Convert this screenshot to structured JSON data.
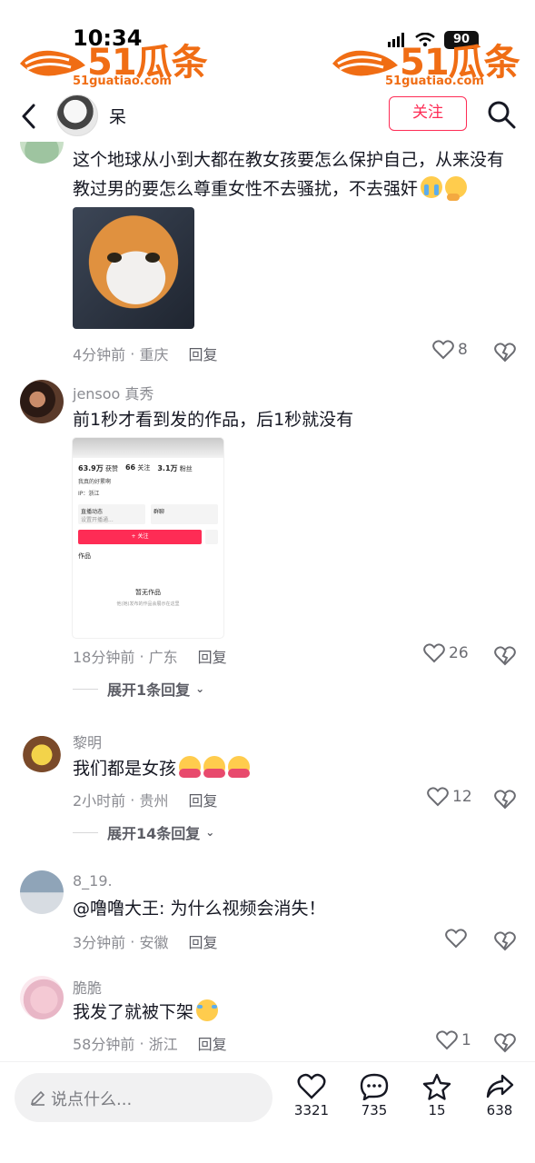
{
  "status_bar": {
    "time": "10:34",
    "battery": "90"
  },
  "watermark": {
    "logo": "51瓜条",
    "url": "51guatiao.com"
  },
  "header": {
    "name": "呆",
    "follow_label": "关注"
  },
  "comments": [
    {
      "username": "",
      "text": "这个地球从小到大都在教女孩要怎么保护自己，从来没有教过男的要怎么尊重女性不去骚扰，不去强奸",
      "emojis": [
        "loudly-crying-face",
        "face-with-peeking-eye"
      ],
      "image": "orange-cat-photo",
      "time": "4分钟前",
      "location": "重庆",
      "reply_label": "回复",
      "likes": "8"
    },
    {
      "username": "jensoo 真秀",
      "text": "前1秒才看到发的作品，后1秒就没有",
      "image": "profile-screenshot",
      "screenshot": {
        "likes": "63.9万",
        "likes_label": "获赞",
        "following": "66",
        "following_label": "关注",
        "followers": "3.1万",
        "followers_label": "粉丝",
        "bio": "我真的好累啊",
        "location": "IP：浙江",
        "card1_title": "直播动态",
        "card1_sub": "设置开播通...",
        "card2_title": "群聊",
        "follow_btn": "+ 关注",
        "tab": "作品",
        "empty_title": "暂无作品",
        "empty_sub": "他(她)发布的作品会展示在这里"
      },
      "time": "18分钟前",
      "location": "广东",
      "reply_label": "回复",
      "likes": "26",
      "expand_label": "展开1条回复"
    },
    {
      "username": "黎明",
      "text": "我们都是女孩",
      "emojis": [
        "hugging-face",
        "hugging-face",
        "hugging-face"
      ],
      "time": "2小时前",
      "location": "贵州",
      "reply_label": "回复",
      "likes": "12",
      "expand_label": "展开14条回复"
    },
    {
      "username": "8_19.",
      "text": "@噜噜大王: 为什么视频会消失！",
      "time": "3分钟前",
      "location": "安徽",
      "reply_label": "回复",
      "likes": ""
    },
    {
      "username": "脆脆",
      "text": "我发了就被下架",
      "emojis": [
        "rolling-on-floor-laughing"
      ],
      "time": "58分钟前",
      "location": "浙江",
      "reply_label": "回复",
      "likes": "1"
    }
  ],
  "bottom_bar": {
    "placeholder": "说点什么...",
    "like_count": "3321",
    "comment_count": "735",
    "favorite_count": "15",
    "share_count": "638"
  },
  "colors": {
    "accent": "#fe2c55",
    "watermark": "#f06d14",
    "meta_text": "#8a8b91"
  }
}
